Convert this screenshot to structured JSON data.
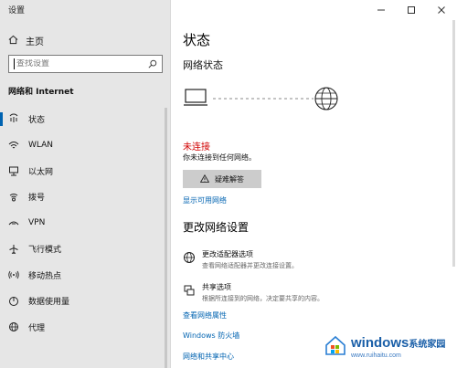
{
  "window": {
    "title": "设置"
  },
  "sidebar": {
    "home_label": "主页",
    "search_placeholder": "查找设置",
    "section_title": "网络和 Internet",
    "items": [
      {
        "label": "状态",
        "icon": "home-status-icon"
      },
      {
        "label": "WLAN",
        "icon": "wifi-icon"
      },
      {
        "label": "以太网",
        "icon": "ethernet-icon"
      },
      {
        "label": "拨号",
        "icon": "dialup-icon"
      },
      {
        "label": "VPN",
        "icon": "vpn-icon"
      },
      {
        "label": "飞行模式",
        "icon": "airplane-icon"
      },
      {
        "label": "移动热点",
        "icon": "hotspot-icon"
      },
      {
        "label": "数据使用量",
        "icon": "data-usage-icon"
      },
      {
        "label": "代理",
        "icon": "globe-icon"
      }
    ]
  },
  "main": {
    "title": "状态",
    "network_status_title": "网络状态",
    "status_text": "未连接",
    "status_detail": "你未连接到任何网络。",
    "troubleshoot_label": "疑难解答",
    "show_networks_link": "显示可用网络",
    "change_settings_title": "更改网络设置",
    "options": [
      {
        "title": "更改适配器选项",
        "desc": "查看网络适配器并更改连接设置。",
        "icon": "adapter-icon"
      },
      {
        "title": "共享选项",
        "desc": "根据所连接到的网络，决定要共享的内容。",
        "icon": "sharing-icon"
      }
    ],
    "links": [
      "查看网络属性",
      "Windows 防火墙",
      "网络和共享中心"
    ]
  },
  "watermark": {
    "main": "windows",
    "cn": "系统家园",
    "sub": "www.ruihaitu.com"
  },
  "colors": {
    "accent": "#0063b1",
    "error": "#d00000",
    "sidebar_bg": "#e6e6e6"
  }
}
